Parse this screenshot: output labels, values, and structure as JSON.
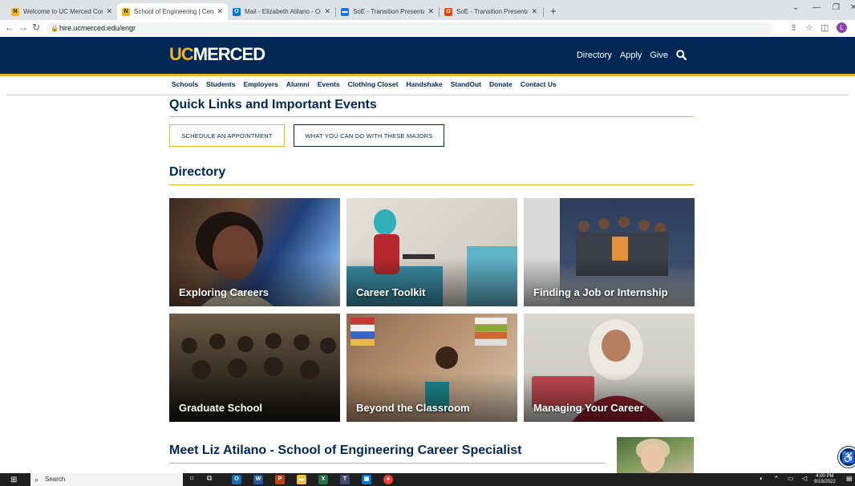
{
  "browser": {
    "tabs": [
      {
        "title": "Welcome to UC Merced Connect",
        "favicon_color": "#f1b51c",
        "favicon": "N"
      },
      {
        "title": "School of Engineering | Center fo",
        "favicon_color": "#f1b51c",
        "favicon": "N",
        "active": true
      },
      {
        "title": "Mail - Elizabeth Atilano - Outloo",
        "favicon_color": "#0078d4",
        "favicon": "O"
      },
      {
        "title": "SoE - Transition Presentation FA",
        "favicon_color": "#1a73e8",
        "favicon": "▬"
      },
      {
        "title": "SoE - Transition Presentation FA",
        "favicon_color": "#e8430d",
        "favicon": "O"
      }
    ],
    "new_tab": "+",
    "url": "hire.ucmerced.edu/engr",
    "profile_initial": "L"
  },
  "header": {
    "logo_uc": "UC",
    "logo_rest": "MERCED",
    "links": [
      "Directory",
      "Apply",
      "Give"
    ]
  },
  "subnav": [
    "Schools",
    "Students",
    "Employers",
    "Alumni",
    "Events",
    "Clothing Closet",
    "Handshake",
    "StandOut",
    "Donate",
    "Contact Us"
  ],
  "quick_links": {
    "heading": "Quick Links and Important Events",
    "buttons": [
      "SCHEDULE AN APPOINTMENT",
      "WHAT YOU CAN DO WITH THESE MAJORS"
    ]
  },
  "directory": {
    "heading": "Directory",
    "cards": [
      {
        "label": "Exploring Careers"
      },
      {
        "label": "Career Toolkit"
      },
      {
        "label": "Finding a Job or Internship"
      },
      {
        "label": "Graduate School"
      },
      {
        "label": "Beyond the Classroom"
      },
      {
        "label": "Managing Your Career"
      }
    ]
  },
  "specialist": {
    "heading": "Meet Liz Atilano - School of Engineering Career Specialist"
  },
  "taskbar": {
    "search_placeholder": "Search",
    "time": "4:00 PM",
    "date": "9/19/2022"
  },
  "colors": {
    "navy": "#002856",
    "gold": "#f1b51c"
  }
}
